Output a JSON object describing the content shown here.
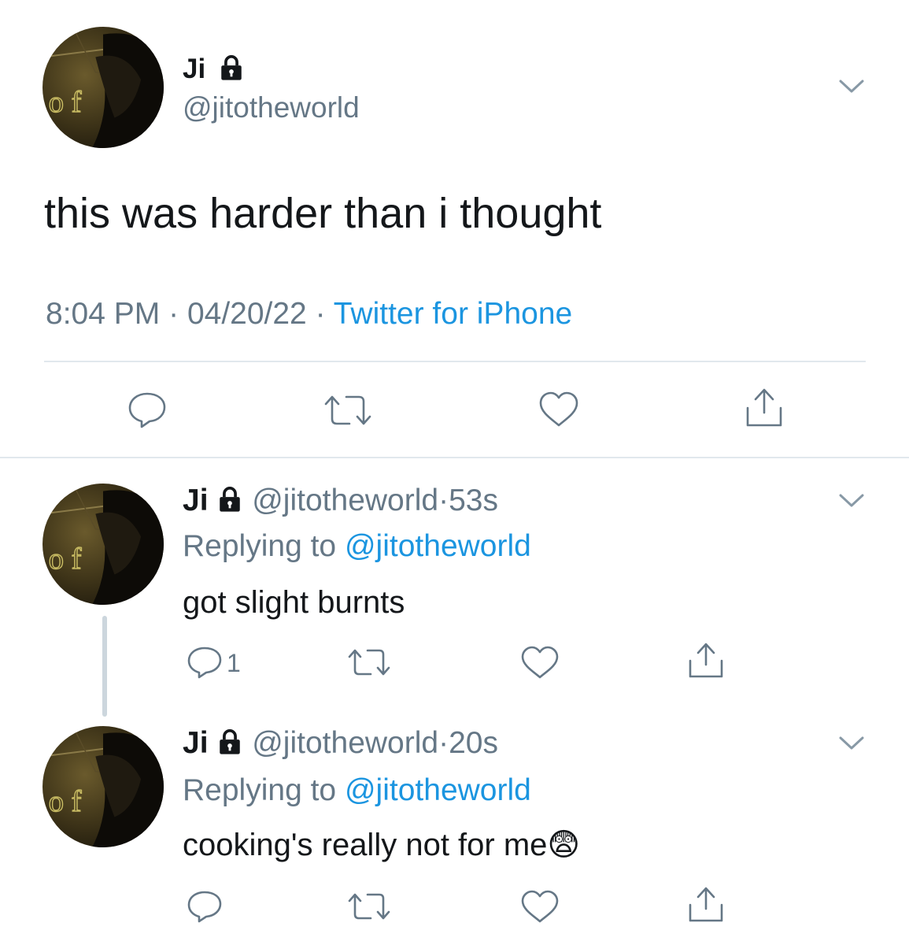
{
  "colors": {
    "accent": "#1b95e0",
    "muted": "#657786",
    "divider": "#e1e8ed",
    "text": "#14171a"
  },
  "main_tweet": {
    "name": "Ji",
    "handle": "@jitotheworld",
    "text": "this was harder than i thought",
    "time": "8:04 PM",
    "date": "04/20/22",
    "separator": "·",
    "source": "Twitter for iPhone",
    "icons": [
      "reply-icon",
      "retweet-icon",
      "like-icon",
      "share-icon"
    ]
  },
  "replies": [
    {
      "name": "Ji",
      "handle": "@jitotheworld",
      "dot": "·",
      "age": "53s",
      "replying_label": "Replying to",
      "replying_handle": "@jitotheworld",
      "text": "got slight burnts",
      "emoji": "",
      "reply_count": "1"
    },
    {
      "name": "Ji",
      "handle": "@jitotheworld",
      "dot": "·",
      "age": "20s",
      "replying_label": "Replying to",
      "replying_handle": "@jitotheworld",
      "text": "cooking's really not for me",
      "emoji": "😨",
      "reply_count": ""
    }
  ]
}
